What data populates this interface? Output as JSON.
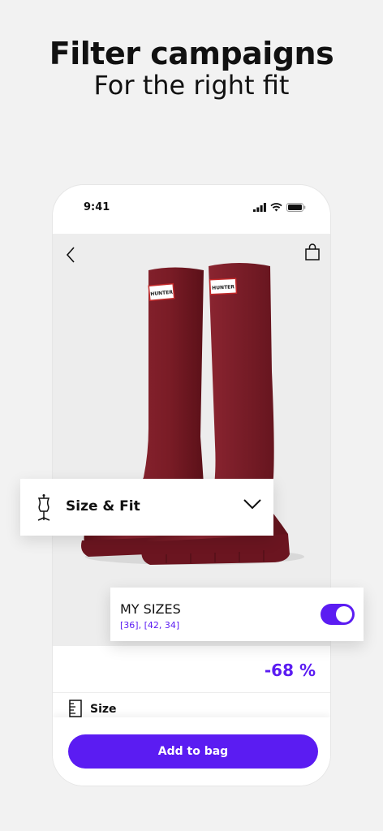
{
  "headline": {
    "title": "Filter campaigns",
    "subtitle": "For the right fit"
  },
  "phone": {
    "status_time": "9:41",
    "icons": [
      "signal-icon",
      "wifi-icon",
      "battery-icon",
      "back-icon",
      "bag-icon"
    ],
    "product": {
      "brand_tag": "HUNTER",
      "discount": "-68 %",
      "size_label": "Size"
    },
    "cta_label": "Add to bag"
  },
  "size_fit": {
    "title": "Size & Fit",
    "icon": "dress-form-icon"
  },
  "my_sizes": {
    "title": "MY SIZES",
    "values": "[36], [42, 34]",
    "toggle_on": true
  },
  "colors": {
    "accent": "#5b1cf2",
    "boot": "#7a1c26",
    "background": "#f2f2f2"
  }
}
